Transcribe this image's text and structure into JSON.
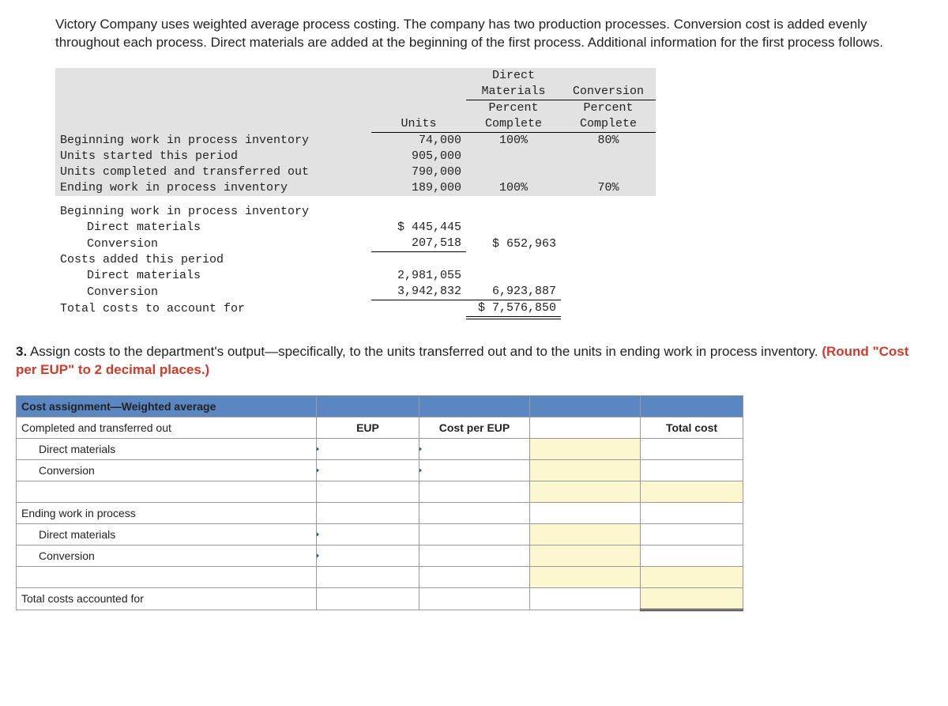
{
  "intro": "Victory Company uses weighted average process costing. The company has two production processes. Conversion cost is added evenly throughout each process. Direct materials are added at the beginning of the first process. Additional information for the first process follows.",
  "dataTable": {
    "hdr": {
      "dm1": "Direct",
      "dm2": "Materials",
      "conv": "Conversion",
      "pct": "Percent",
      "units": "Units",
      "complete": "Complete"
    },
    "rows": {
      "bwip": {
        "label": "Beginning work in process inventory",
        "units": "74,000",
        "dm": "100%",
        "cv": "80%"
      },
      "started": {
        "label": "Units started this period",
        "units": "905,000"
      },
      "completed": {
        "label": "Units completed and transferred out",
        "units": "790,000"
      },
      "ewip": {
        "label": "Ending work in process inventory",
        "units": "189,000",
        "dm": "100%",
        "cv": "70%"
      }
    },
    "costs": {
      "bwip_label": "Beginning work in process inventory",
      "dm_label": "Direct materials",
      "conv_label": "Conversion",
      "bwip_dm": "$ 445,445",
      "bwip_cv": "207,518",
      "bwip_tot": "$ 652,963",
      "added_label": "Costs added this period",
      "added_dm": "2,981,055",
      "added_cv": "3,942,832",
      "added_tot": "6,923,887",
      "total_label": "Total costs to account for",
      "total": "$ 7,576,850"
    }
  },
  "q3": {
    "num": "3.",
    "text": " Assign costs to the department's output—specifically, to the units transferred out and to the units in ending work in process inventory. ",
    "red": "(Round \"Cost per EUP\" to 2 decimal places.)"
  },
  "answer": {
    "h1": "Cost assignment—Weighted average",
    "cto": "Completed and transferred out",
    "eup": "EUP",
    "cpe": "Cost per EUP",
    "tot": "Total cost",
    "dm": "Direct materials",
    "cv": "Conversion",
    "ewip": "Ending work in process",
    "tcaf": "Total costs accounted for"
  }
}
